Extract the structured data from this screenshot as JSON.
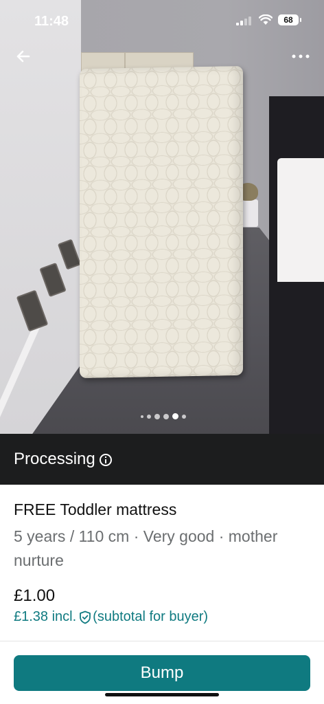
{
  "status_bar": {
    "time": "11:48",
    "battery": "68"
  },
  "photo": {
    "dots_count": 6,
    "active_dot": 4
  },
  "banner": {
    "label": "Processing"
  },
  "listing": {
    "title": "FREE Toddler mattress",
    "subtitle": "5 years / 110 cm · Very good · mother nurture",
    "price": "£1.00",
    "price_incl": "£1.38 incl.",
    "price_note": "(subtotal for buyer)"
  },
  "actions": {
    "bump_label": "Bump"
  },
  "colors": {
    "accent": "#0f7a80",
    "banner_bg": "#1c1d1e",
    "muted_text": "#6b6e70"
  },
  "icons": [
    "back-arrow-icon",
    "more-options-icon",
    "info-icon",
    "shield-icon"
  ]
}
